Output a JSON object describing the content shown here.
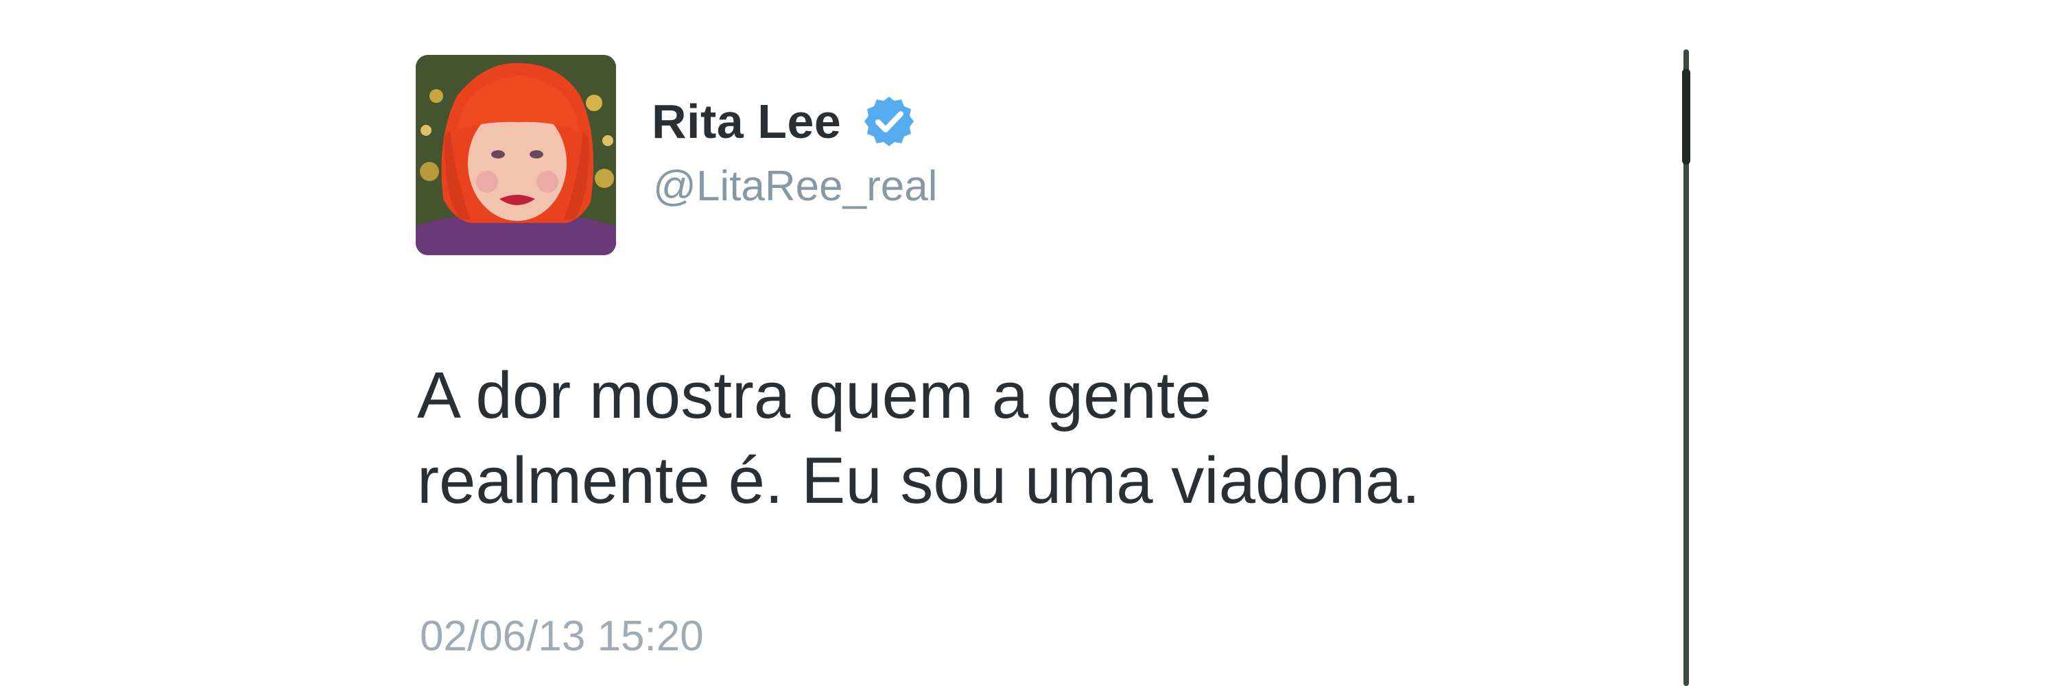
{
  "tweet": {
    "display_name": "Rita Lee",
    "handle": "@LitaRee_real",
    "verified": true,
    "text_lines": [
      "A dor mostra quem a gente",
      "realmente é. Eu sou uma viadona."
    ],
    "timestamp": "02/06/13 15:20"
  },
  "icons": {
    "verified": "verified-check-icon",
    "avatar": "profile-avatar"
  },
  "colors": {
    "name_text": "#292f33",
    "handle_text": "#8899a6",
    "timestamp_text": "#a0acb5",
    "verified_badge": "#55acee",
    "avatar_hair": "#e8421f"
  }
}
